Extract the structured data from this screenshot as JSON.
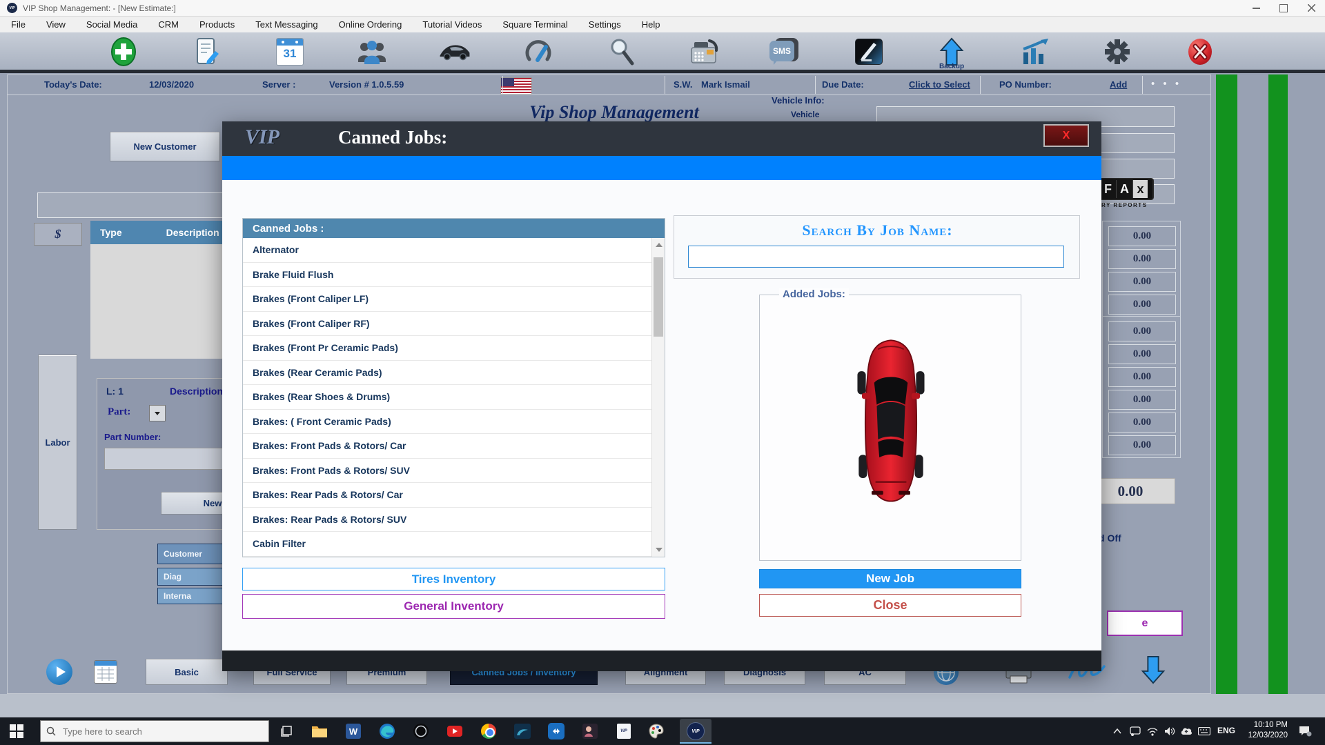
{
  "window": {
    "title": "VIP Shop Management:  - [New Estimate:]",
    "logo": "VIP"
  },
  "menu": {
    "items": [
      "File",
      "View",
      "Social Media",
      "CRM",
      "Products",
      "Text Messaging",
      "Online Ordering",
      "Tutorial Videos",
      "Square Terminal",
      "Settings",
      "Help"
    ]
  },
  "toolbar": {
    "icons": [
      "add-icon",
      "edit-estimate-icon",
      "calendar-icon",
      "customers-icon",
      "vehicle-icon",
      "gauge-icon",
      "search-icon",
      "fax-icon",
      "sms-icon",
      "signature-icon",
      "backup-icon",
      "reports-icon",
      "settings-icon",
      "exit-icon"
    ],
    "calendar_day": "31",
    "sms_label": "SMS",
    "backup_label": "Backup"
  },
  "infobar": {
    "today_label": "Today's Date:",
    "today_value": "12/03/2020",
    "server_label": "Server :",
    "version": "Version # 1.0.5.59",
    "sw_label": "S.W.",
    "sw_value": "Mark Ismail",
    "due_label": "Due Date:",
    "due_link": "Click to Select",
    "po_label": "PO Number:",
    "po_link": "Add",
    "more_dots": "• • •"
  },
  "background": {
    "script_title": "Vip Shop Management",
    "new_customer": "New Customer",
    "dollar": "$",
    "table": {
      "col_type": "Type",
      "col_desc": "Description of Pa"
    },
    "line_label": "L: 1",
    "desc_label": "Description",
    "part_label": "Part:",
    "part_number_label": "Part Number:",
    "labor": "Labor",
    "new_btn": "New",
    "customer_btn": "Customer",
    "diag_btn": "Diag",
    "internal_btn": "Interna",
    "vehicle_info_label": "Vehicle Info:",
    "vehicle_partial": "Vehicle",
    "carfax": {
      "f": "F",
      "a": "A",
      "x": "x",
      "caption": "TORY REPORTS"
    },
    "values_a": [
      "0.00",
      "0.00",
      "0.00",
      "0.00"
    ],
    "values_b": [
      "0.00",
      "0.00",
      "0.00",
      "0.00",
      "0.00",
      "0.00"
    ],
    "big_total": "0.00",
    "signed_off_partial": "d Off",
    "purple_btn_partial": "e",
    "bottom_buttons": [
      "Basic",
      "Full Service",
      "Premium",
      "Canned Jobs / Inventory",
      "Alignment",
      "Diagnosis",
      "AC"
    ]
  },
  "modal": {
    "logo": "VIP",
    "title": "Canned Jobs:",
    "close_x": "X",
    "list_header": "Canned Jobs :",
    "jobs": [
      "Alternator",
      "Brake Fluid Flush",
      "Brakes (Front Caliper LF)",
      "Brakes (Front Caliper RF)",
      "Brakes (Front Pr Ceramic Pads)",
      "Brakes (Rear Ceramic Pads)",
      "Brakes (Rear Shoes & Drums)",
      "Brakes: ( Front Ceramic Pads)",
      "Brakes: Front Pads & Rotors/ Car",
      "Brakes: Front Pads & Rotors/ SUV",
      "Brakes: Rear Pads & Rotors/ Car",
      "Brakes: Rear Pads & Rotors/ SUV",
      "Cabin Filter"
    ],
    "tires_btn": "Tires Inventory",
    "general_btn": "General Inventory",
    "search_label": "Search By Job Name:",
    "added_jobs_label": "Added Jobs:",
    "new_job_btn": "New Job",
    "close_btn": "Close"
  },
  "taskbar": {
    "search_placeholder": "Type here to search",
    "app_icons": [
      "task-view",
      "file-explorer",
      "word",
      "edge",
      "browser",
      "youtube",
      "chrome",
      "mysql",
      "teamviewer",
      "photos",
      "vip-doc",
      "paint",
      "vip-app"
    ],
    "word_letter": "W",
    "vip_letters": "VIP",
    "lang": "ENG",
    "time": "10:10 PM",
    "date": "12/03/2020"
  },
  "colors": {
    "accent_blue": "#2196f3",
    "purple": "#9c27b0",
    "green_bar": "#12921e",
    "close_red": "#c0504d",
    "modal_header": "#2f353e",
    "blue_strip": "#0081fe",
    "list_header_bg": "#4f87ae"
  }
}
